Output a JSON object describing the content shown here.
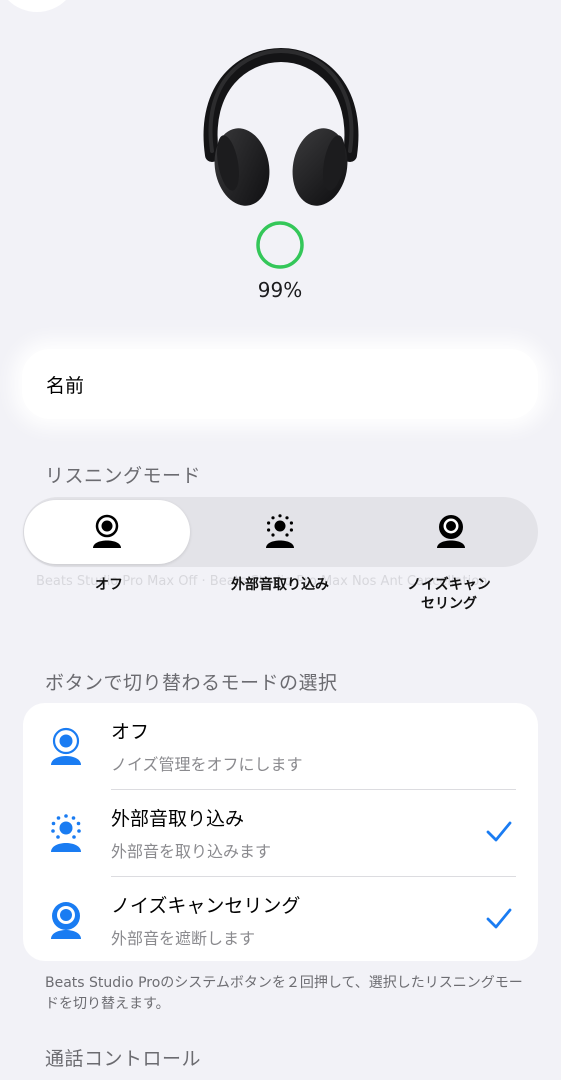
{
  "device": {
    "battery_percent": "99%",
    "battery_level": 0.99,
    "battery_color": "#34c759"
  },
  "name_row": {
    "label": "名前"
  },
  "listening_mode": {
    "section_title": "リスニングモード",
    "segments": [
      {
        "label": "オフ",
        "icon": "person-icon",
        "selected": true
      },
      {
        "label": "外部音取り込み",
        "icon": "transparency-person-icon",
        "selected": false
      },
      {
        "label": "ノイズキャン\nセリング",
        "icon": "noise-cancel-person-icon",
        "selected": false
      }
    ],
    "ghost_text": "Beats Studio Pro Max Off · Beats Studio Pro Max Nos Ant Cancellation"
  },
  "button_modes": {
    "section_title": "ボタンで切り替わるモードの選択",
    "accent_color": "#1a7cf2",
    "items": [
      {
        "title": "オフ",
        "subtitle": "ノイズ管理をオフにします",
        "checked": false,
        "icon": "person-icon"
      },
      {
        "title": "外部音取り込み",
        "subtitle": "外部音を取り込みます",
        "checked": true,
        "icon": "transparency-person-icon"
      },
      {
        "title": "ノイズキャンセリング",
        "subtitle": "外部音を遮断します",
        "checked": true,
        "icon": "noise-cancel-person-icon"
      }
    ],
    "footnote": "Beats Studio Proのシステムボタンを２回押して、選択したリスニングモードを切り替えます。"
  },
  "call_controls": {
    "section_title": "通話コントロール"
  }
}
